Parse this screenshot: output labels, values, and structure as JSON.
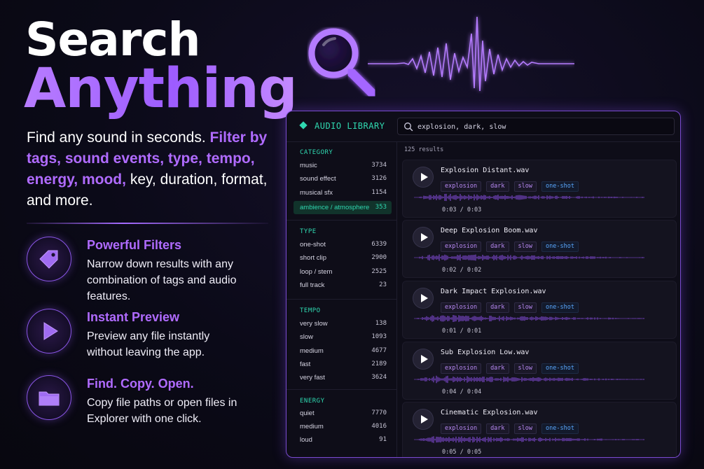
{
  "hero": {
    "title_line1": "Search",
    "title_line2": "Anything",
    "tagline_white1": "Find any sound in seconds.",
    "tagline_purple": "Filter by tags, sound events, type, tempo, energy, mood,",
    "tagline_white2": "key, duration, format, and more."
  },
  "features": [
    {
      "icon": "tag-icon",
      "title": "Powerful Filters",
      "desc": "Narrow down results with any combination of tags and audio features."
    },
    {
      "icon": "play-icon",
      "title": "Instant Preview",
      "desc": "Preview any file instantly without leaving the app."
    },
    {
      "icon": "folder-icon",
      "title": "Find. Copy. Open.",
      "desc": "Copy file paths or open files in Explorer with one click."
    }
  ],
  "app": {
    "title": "AUDIO LIBRARY",
    "search_value": "explosion, dark, slow",
    "results_count": "125 results"
  },
  "sidebar": {
    "category": {
      "heading": "CATEGORY",
      "items": [
        {
          "label": "music",
          "count": "3734"
        },
        {
          "label": "sound effect",
          "count": "3126"
        },
        {
          "label": "musical sfx",
          "count": "1154"
        },
        {
          "label": "ambience / atmosphere",
          "count": "353"
        }
      ]
    },
    "type": {
      "heading": "TYPE",
      "items": [
        {
          "label": "one-shot",
          "count": "6339"
        },
        {
          "label": "short clip",
          "count": "2900"
        },
        {
          "label": "loop / stem",
          "count": "2525"
        },
        {
          "label": "full track",
          "count": "23"
        }
      ]
    },
    "tempo": {
      "heading": "TEMPO",
      "items": [
        {
          "label": "very slow",
          "count": "138"
        },
        {
          "label": "slow",
          "count": "1093"
        },
        {
          "label": "medium",
          "count": "4677"
        },
        {
          "label": "fast",
          "count": "2189"
        },
        {
          "label": "very fast",
          "count": "3624"
        }
      ]
    },
    "energy": {
      "heading": "ENERGY",
      "items": [
        {
          "label": "quiet",
          "count": "7770"
        },
        {
          "label": "medium",
          "count": "4016"
        },
        {
          "label": "loud",
          "count": "91"
        }
      ]
    }
  },
  "results": [
    {
      "name": "Explosion Distant.wav",
      "tags": [
        "explosion",
        "dark",
        "slow",
        "one-shot"
      ],
      "time": "0:03 / 0:03"
    },
    {
      "name": "Deep Explosion Boom.wav",
      "tags": [
        "explosion",
        "dark",
        "slow",
        "one-shot"
      ],
      "time": "0:02 / 0:02"
    },
    {
      "name": "Dark Impact Explosion.wav",
      "tags": [
        "explosion",
        "dark",
        "slow",
        "one-shot"
      ],
      "time": "0:01 / 0:01"
    },
    {
      "name": "Sub Explosion Low.wav",
      "tags": [
        "explosion",
        "dark",
        "slow",
        "one-shot"
      ],
      "time": "0:04 / 0:04"
    },
    {
      "name": "Cinematic Explosion.wav",
      "tags": [
        "explosion",
        "dark",
        "slow",
        "one-shot"
      ],
      "time": "0:05 / 0:05"
    }
  ],
  "colors": {
    "accent": "#b06bff",
    "teal": "#2fd8b0",
    "blue_tag": "#5aa8ff"
  }
}
